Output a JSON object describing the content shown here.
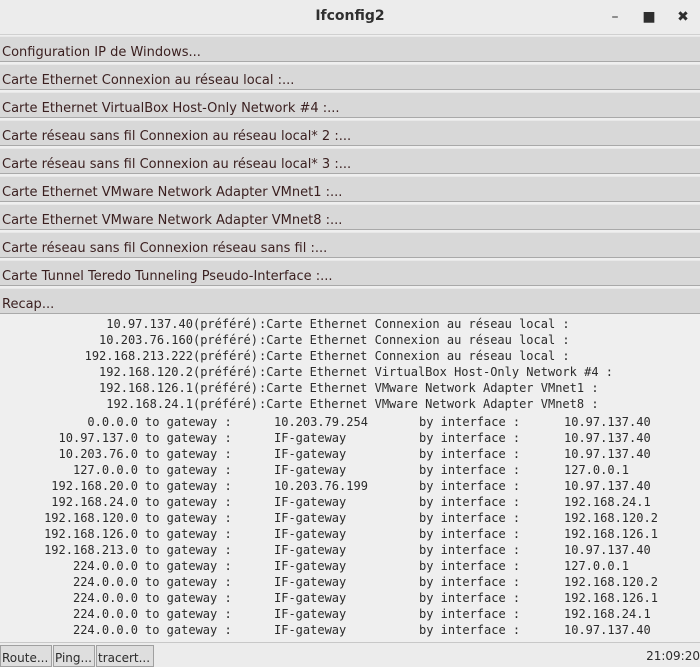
{
  "window": {
    "title": "Ifconfig2",
    "minimize": "–",
    "maximize": "■",
    "close": "✖"
  },
  "sections": [
    "Configuration IP de Windows...",
    "Carte Ethernet Connexion au réseau local :...",
    "Carte Ethernet VirtualBox Host-Only Network #4 :...",
    "Carte réseau sans fil Connexion au réseau local* 2 :...",
    "Carte réseau sans fil Connexion au réseau local* 3 :...",
    "Carte Ethernet VMware Network Adapter VMnet1 :...",
    "Carte Ethernet VMware Network Adapter VMnet8 :...",
    "Carte réseau sans fil Connexion réseau sans fil :...",
    "Carte Tunnel Teredo Tunneling Pseudo-Interface :...",
    "Recap..."
  ],
  "preferred": [
    {
      "ip": "10.97.137.40(préféré)",
      "desc": ":Carte Ethernet Connexion au réseau local :"
    },
    {
      "ip": "10.203.76.160(préféré)",
      "desc": ":Carte Ethernet Connexion au réseau local :"
    },
    {
      "ip": "192.168.213.222(préféré)",
      "desc": ":Carte Ethernet Connexion au réseau local :"
    },
    {
      "ip": "192.168.120.2(préféré)",
      "desc": ":Carte Ethernet VirtualBox Host-Only Network #4 :"
    },
    {
      "ip": "192.168.126.1(préféré)",
      "desc": ":Carte Ethernet VMware Network Adapter VMnet1 :"
    },
    {
      "ip": "192.168.24.1(préféré)",
      "desc": ":Carte Ethernet VMware Network Adapter VMnet8 :"
    }
  ],
  "routes": [
    {
      "dest": "0.0.0.0",
      "to": "to gateway :",
      "gw": "10.203.79.254",
      "by": "by interface :",
      "iface": "10.97.137.40"
    },
    {
      "dest": "10.97.137.0",
      "to": "to gateway :",
      "gw": "IF-gateway",
      "by": "by interface :",
      "iface": "10.97.137.40"
    },
    {
      "dest": "10.203.76.0",
      "to": "to gateway :",
      "gw": "IF-gateway",
      "by": "by interface :",
      "iface": "10.97.137.40"
    },
    {
      "dest": "127.0.0.0",
      "to": "to gateway :",
      "gw": "IF-gateway",
      "by": "by interface :",
      "iface": "127.0.0.1"
    },
    {
      "dest": "192.168.20.0",
      "to": "to gateway :",
      "gw": "10.203.76.199",
      "by": "by interface :",
      "iface": "10.97.137.40"
    },
    {
      "dest": "192.168.24.0",
      "to": "to gateway :",
      "gw": "IF-gateway",
      "by": "by interface :",
      "iface": "192.168.24.1"
    },
    {
      "dest": "192.168.120.0",
      "to": "to gateway :",
      "gw": "IF-gateway",
      "by": "by interface :",
      "iface": "192.168.120.2"
    },
    {
      "dest": "192.168.126.0",
      "to": "to gateway :",
      "gw": "IF-gateway",
      "by": "by interface :",
      "iface": "192.168.126.1"
    },
    {
      "dest": "192.168.213.0",
      "to": "to gateway :",
      "gw": "IF-gateway",
      "by": "by interface :",
      "iface": "10.97.137.40"
    },
    {
      "dest": "224.0.0.0",
      "to": "to gateway :",
      "gw": "IF-gateway",
      "by": "by interface :",
      "iface": "127.0.0.1"
    },
    {
      "dest": "224.0.0.0",
      "to": "to gateway :",
      "gw": "IF-gateway",
      "by": "by interface :",
      "iface": "192.168.120.2"
    },
    {
      "dest": "224.0.0.0",
      "to": "to gateway :",
      "gw": "IF-gateway",
      "by": "by interface :",
      "iface": "192.168.126.1"
    },
    {
      "dest": "224.0.0.0",
      "to": "to gateway :",
      "gw": "IF-gateway",
      "by": "by interface :",
      "iface": "192.168.24.1"
    },
    {
      "dest": "224.0.0.0",
      "to": "to gateway :",
      "gw": "IF-gateway",
      "by": "by interface :",
      "iface": "10.97.137.40"
    }
  ],
  "statusbar": {
    "buttons": [
      "Route...",
      "Ping...",
      "tracert..."
    ],
    "clock": "21:09:20"
  }
}
